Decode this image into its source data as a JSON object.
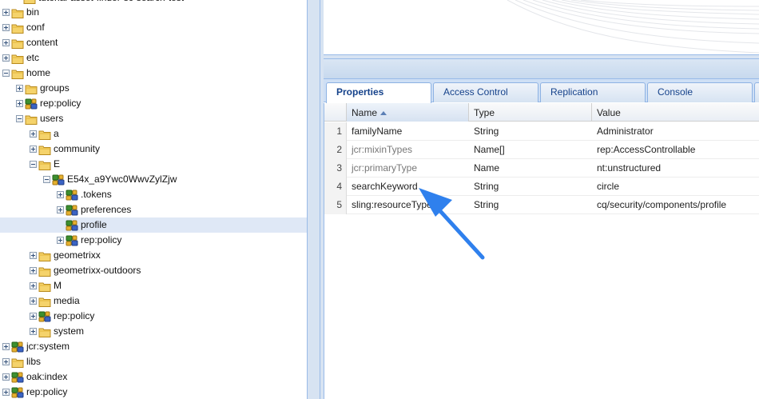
{
  "tree": {
    "top_partial_label": "tutorial-asset-finder-sc-search-test",
    "items": [
      {
        "label": "bin",
        "depth": 0,
        "icon": "folder",
        "expander": "plus"
      },
      {
        "label": "conf",
        "depth": 0,
        "icon": "folder",
        "expander": "plus"
      },
      {
        "label": "content",
        "depth": 0,
        "icon": "folder",
        "expander": "plus"
      },
      {
        "label": "etc",
        "depth": 0,
        "icon": "folder",
        "expander": "plus"
      },
      {
        "label": "home",
        "depth": 0,
        "icon": "folder",
        "expander": "minus"
      },
      {
        "label": "groups",
        "depth": 1,
        "icon": "folder",
        "expander": "plus"
      },
      {
        "label": "rep:policy",
        "depth": 1,
        "icon": "node",
        "expander": "plus"
      },
      {
        "label": "users",
        "depth": 1,
        "icon": "folder",
        "expander": "minus"
      },
      {
        "label": "a",
        "depth": 2,
        "icon": "folder",
        "expander": "plus"
      },
      {
        "label": "community",
        "depth": 2,
        "icon": "folder",
        "expander": "plus"
      },
      {
        "label": "E",
        "depth": 2,
        "icon": "folder",
        "expander": "minus"
      },
      {
        "label": "E54x_a9Ywc0WwvZylZjw",
        "depth": 3,
        "icon": "node",
        "expander": "minus"
      },
      {
        "label": ".tokens",
        "depth": 4,
        "icon": "node",
        "expander": "plus"
      },
      {
        "label": "preferences",
        "depth": 4,
        "icon": "node",
        "expander": "plus"
      },
      {
        "label": "profile",
        "depth": 4,
        "icon": "node",
        "expander": "none",
        "selected": true
      },
      {
        "label": "rep:policy",
        "depth": 4,
        "icon": "node",
        "expander": "plus"
      },
      {
        "label": "geometrixx",
        "depth": 2,
        "icon": "folder",
        "expander": "plus"
      },
      {
        "label": "geometrixx-outdoors",
        "depth": 2,
        "icon": "folder",
        "expander": "plus"
      },
      {
        "label": "M",
        "depth": 2,
        "icon": "folder",
        "expander": "plus"
      },
      {
        "label": "media",
        "depth": 2,
        "icon": "folder",
        "expander": "plus"
      },
      {
        "label": "rep:policy",
        "depth": 2,
        "icon": "node",
        "expander": "plus"
      },
      {
        "label": "system",
        "depth": 2,
        "icon": "folder",
        "expander": "plus"
      },
      {
        "label": "jcr:system",
        "depth": 0,
        "icon": "node",
        "expander": "plus"
      },
      {
        "label": "libs",
        "depth": 0,
        "icon": "folder",
        "expander": "plus"
      },
      {
        "label": "oak:index",
        "depth": 0,
        "icon": "node",
        "expander": "plus"
      },
      {
        "label": "rep:policy",
        "depth": 0,
        "icon": "node",
        "expander": "plus"
      }
    ]
  },
  "tabs": [
    {
      "label": "Properties",
      "active": true
    },
    {
      "label": "Access Control",
      "active": false
    },
    {
      "label": "Replication",
      "active": false
    },
    {
      "label": "Console",
      "active": false
    }
  ],
  "grid": {
    "columns": {
      "name": "Name",
      "type": "Type",
      "value": "Value"
    },
    "rows": [
      {
        "num": "1",
        "name": "familyName",
        "type": "String",
        "value": "Administrator",
        "protected": false
      },
      {
        "num": "2",
        "name": "jcr:mixinTypes",
        "type": "Name[]",
        "value": "rep:AccessControllable",
        "protected": true
      },
      {
        "num": "3",
        "name": "jcr:primaryType",
        "type": "Name",
        "value": "nt:unstructured",
        "protected": true
      },
      {
        "num": "4",
        "name": "searchKeyword",
        "type": "String",
        "value": "circle",
        "protected": false
      },
      {
        "num": "5",
        "name": "sling:resourceType",
        "type": "String",
        "value": "cq/security/components/profile",
        "protected": false
      }
    ]
  },
  "colors": {
    "accent": "#99bbe8",
    "tab_text": "#15428b",
    "selection": "#dfe8f6",
    "annotation_arrow": "#2f80ed"
  }
}
